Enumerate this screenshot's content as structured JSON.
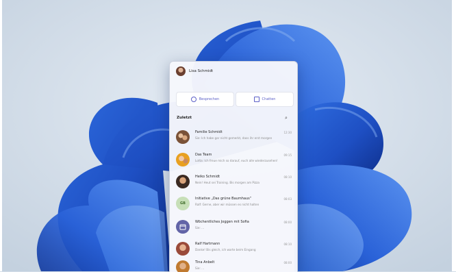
{
  "panel": {
    "user_name": "Lisa Schmidt",
    "actions": {
      "meet_label": "Besprechen",
      "chat_label": "Chatten"
    },
    "section_title": "Zuletzt",
    "chats": [
      {
        "name": "Familie Schmidt",
        "preview": "Sie: Ich habe gar nicht gemerkt, dass ihr erst morgen",
        "time": "12:30",
        "avatar": "group-photo"
      },
      {
        "name": "Das Team",
        "preview": "Lotta: Ich freue mich so darauf, euch alle wiederzusehen!",
        "time": "09:15",
        "avatar": "group-photo"
      },
      {
        "name": "Heiko Schmidt",
        "preview": "Nein! Heut sei Training. Bis morgen am Pizza",
        "time": "08:10",
        "avatar": "person-photo"
      },
      {
        "name": "Initiative „Das grüne Baumhaus“",
        "preview": "Ralf: Gerne, aber wir müssen es nicht halten",
        "time": "08:03",
        "avatar_text": "GB"
      },
      {
        "name": "Wöchentliches Joggen mit Sofia",
        "preview": "Sie: ...",
        "time": "08:00",
        "avatar": "calendar"
      },
      {
        "name": "Ralf Hartmann",
        "preview": "Danke! Bis gleich, ich warte beim Eingang",
        "time": "08:10",
        "avatar": "person-photo"
      },
      {
        "name": "Tina Anbelt",
        "preview": "Sie: ...",
        "time": "08:00",
        "avatar": "person-photo"
      }
    ]
  },
  "icons": {
    "meet_icon": "video-icon",
    "chat_icon": "compose-icon",
    "new_chat_icon": "new-chat-icon"
  }
}
